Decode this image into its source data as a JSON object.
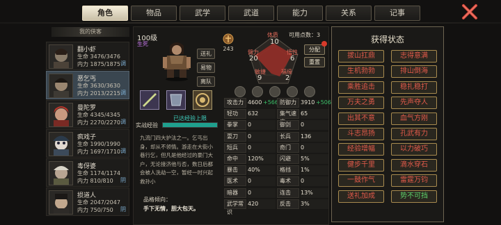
{
  "tabs": [
    "角色",
    "物品",
    "武学",
    "武道",
    "能力",
    "关系",
    "记事"
  ],
  "active_tab": "角色",
  "roster": {
    "title": "我的侠客",
    "members": [
      {
        "name": "翻小虾",
        "hp": "生命 3476/3476",
        "mp": "内力 1875/1875",
        "tag": "调"
      },
      {
        "name": "恶乞丐",
        "hp": "生命 3630/3630",
        "mp": "内力 2013/2215",
        "tag": "调"
      },
      {
        "name": "曼陀罗",
        "hp": "生命 4345/4345",
        "mp": "内力 2270/2270",
        "tag": "调"
      },
      {
        "name": "疯戏子",
        "hp": "生命 1990/1990",
        "mp": "内力 1697/1710",
        "tag": "调"
      },
      {
        "name": "毒伢婆",
        "hp": "生命 1174/1174",
        "mp": "内力 810/810",
        "tag": "阴"
      },
      {
        "name": "损道人",
        "hp": "生命 2047/2047",
        "mp": "内力 750/750",
        "tag": "阴"
      }
    ]
  },
  "character": {
    "level": "100级",
    "status": "生死",
    "buttons": [
      "送礼",
      "易物",
      "离队"
    ],
    "potential": "243",
    "points_label": "可用点数：3",
    "allocate": "分配",
    "reset": "重置",
    "attributes": [
      {
        "name": "体质",
        "value": "10"
      },
      {
        "name": "臂力",
        "value": "20"
      },
      {
        "name": "悟性",
        "value": "6"
      },
      {
        "name": "敏捷",
        "value": "9"
      },
      {
        "name": "福缘",
        "value": "2"
      }
    ],
    "exp_label": "实战经验",
    "exp_text": "已达经验上限",
    "exp_progress": 1.0,
    "description": "九流门四大护法之一。乞丐出身，却从不领情。游走在大街小巷行乞，但凡是他经过的豪门大户，无论接济他与否，数日后都会被人洗劫一空，暂经一时兴起救孙小",
    "quality_label": "品格倾向：",
    "quality_value": "手下无情，胆大包天。"
  },
  "stats": [
    {
      "left": "攻击力",
      "left_val": "4600",
      "left_bonus": "+566",
      "right": "防御力",
      "right_val": "3910",
      "right_bonus": "+506"
    },
    {
      "left": "轻功",
      "left_val": "632",
      "right": "集气速度",
      "right_val": "65"
    },
    {
      "left": "拳掌",
      "left_val": "0",
      "right": "御剑",
      "right_val": "0"
    },
    {
      "left": "耍刀",
      "left_val": "0",
      "right": "长兵",
      "right_val": "136"
    },
    {
      "left": "短兵",
      "left_val": "0",
      "right": "奇门",
      "right_val": "0"
    },
    {
      "left": "命中",
      "left_val": "120%",
      "right": "闪避",
      "right_val": "5%"
    },
    {
      "left": "暴击",
      "left_val": "40%",
      "right": "格挡",
      "right_val": "1%"
    },
    {
      "left": "医术",
      "left_val": "0",
      "right": "毒术",
      "right_val": "0"
    },
    {
      "left": "暗器",
      "left_val": "0",
      "right": "连击",
      "right_val": "13%"
    },
    {
      "left": "武学常识",
      "left_val": "420",
      "right": "反击",
      "right_val": "3%"
    }
  ],
  "buffs": {
    "title": "获得状态",
    "items": [
      {
        "label": "拔山扛鼎",
        "color": "red"
      },
      {
        "label": "志得意满",
        "color": "red"
      },
      {
        "label": "生机勃勃",
        "color": "red"
      },
      {
        "label": "排山倒海",
        "color": "red"
      },
      {
        "label": "乘胜追击",
        "color": "red"
      },
      {
        "label": "稳扎稳打",
        "color": "red"
      },
      {
        "label": "万夫之勇",
        "color": "red"
      },
      {
        "label": "先声夺人",
        "color": "red"
      },
      {
        "label": "出其不意",
        "color": "red"
      },
      {
        "label": "血气方刚",
        "color": "red"
      },
      {
        "label": "斗志昂扬",
        "color": "red"
      },
      {
        "label": "孔武有力",
        "color": "red"
      },
      {
        "label": "经验增幅",
        "color": "red"
      },
      {
        "label": "以力破巧",
        "color": "red"
      },
      {
        "label": "健步千里",
        "color": "red"
      },
      {
        "label": "滴水穿石",
        "color": "red"
      },
      {
        "label": "一鼓作气",
        "color": "red"
      },
      {
        "label": "雷霆万钧",
        "color": "red"
      },
      {
        "label": "送礼加成",
        "color": "red"
      },
      {
        "label": "势不可挡",
        "color": "green"
      }
    ]
  },
  "colors": {
    "accent": "#e8dcc0",
    "buff_red": "#e15a4a",
    "buff_green": "#5fcf6a",
    "exp": "#1fa08e"
  }
}
